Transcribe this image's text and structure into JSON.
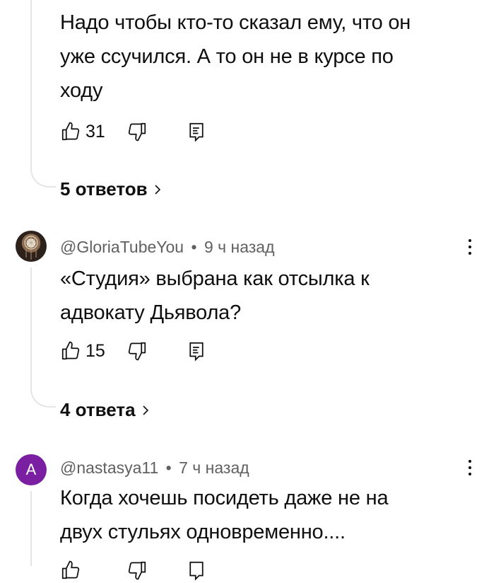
{
  "comments": [
    {
      "author": "",
      "time": "",
      "text_lines": [
        "Надо чтобы кто-то сказал ему, что он",
        "уже ссучился. А то он не в курсе по",
        "ходу"
      ],
      "likes": "31",
      "replies_label": "5 ответов"
    },
    {
      "author": "@GloriaTubeYou",
      "time": "9 ч назад",
      "separator": "•",
      "text_lines": [
        "«Студия» выбрана как отсылка к",
        "адвокату Дьявола?"
      ],
      "likes": "15",
      "replies_label": "4 ответа"
    },
    {
      "author": "@nastasya11",
      "avatar_letter": "A",
      "time": "7 ч назад",
      "separator": "•",
      "text_lines": [
        "Когда хочешь посидеть даже не на",
        "двух стульях одновременно...."
      ]
    }
  ],
  "icons": {
    "like": "thumb-up-icon",
    "dislike": "thumb-down-icon",
    "reply": "reply-icon",
    "more": "more-vertical-icon",
    "chevron": "chevron-right-icon"
  },
  "colors": {
    "avatar_letter_bg": "#7b1fa2",
    "meta_text": "#606060",
    "thread_line": "#e5e5e5"
  }
}
